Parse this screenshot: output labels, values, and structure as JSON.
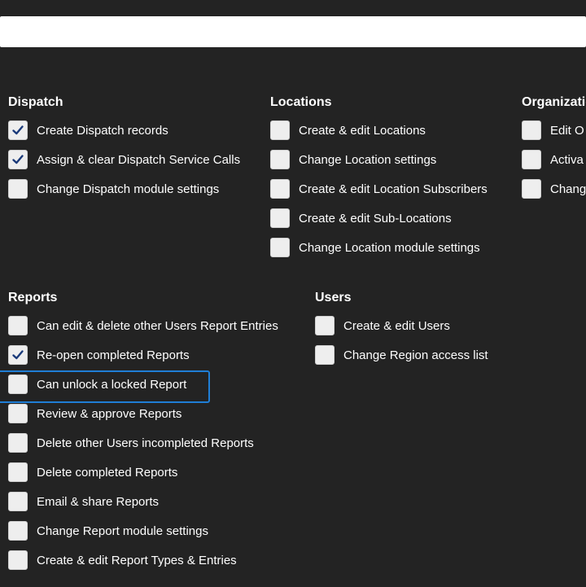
{
  "search": {
    "value": ""
  },
  "dispatch": {
    "title": "Dispatch",
    "items": [
      {
        "label": "Create Dispatch records",
        "checked": true
      },
      {
        "label": "Assign & clear Dispatch Service Calls",
        "checked": true
      },
      {
        "label": "Change Dispatch module settings",
        "checked": false
      }
    ]
  },
  "locations": {
    "title": "Locations",
    "items": [
      {
        "label": "Create & edit Locations",
        "checked": false
      },
      {
        "label": "Change Location settings",
        "checked": false
      },
      {
        "label": "Create & edit Location Subscribers",
        "checked": false
      },
      {
        "label": "Create & edit Sub-Locations",
        "checked": false
      },
      {
        "label": "Change Location module settings",
        "checked": false
      }
    ]
  },
  "organization": {
    "title": "Organizatio",
    "items": [
      {
        "label": "Edit O",
        "checked": false
      },
      {
        "label": "Activa",
        "checked": false
      },
      {
        "label": "Chang",
        "checked": false
      }
    ]
  },
  "reports": {
    "title": "Reports",
    "items": [
      {
        "label": "Can edit & delete other Users Report Entries",
        "checked": false
      },
      {
        "label": "Re-open completed Reports",
        "checked": true
      },
      {
        "label": "Can unlock a locked Report",
        "checked": false,
        "focused": true
      },
      {
        "label": "Review & approve Reports",
        "checked": false
      },
      {
        "label": "Delete other Users incompleted Reports",
        "checked": false
      },
      {
        "label": "Delete completed Reports",
        "checked": false
      },
      {
        "label": "Email & share Reports",
        "checked": false
      },
      {
        "label": "Change Report module settings",
        "checked": false
      },
      {
        "label": "Create & edit Report Types & Entries",
        "checked": false
      }
    ]
  },
  "users": {
    "title": "Users",
    "items": [
      {
        "label": "Create & edit Users",
        "checked": false
      },
      {
        "label": "Change Region access list",
        "checked": false
      }
    ]
  },
  "colors": {
    "check": "#1a3a7a",
    "focus": "#1f7ed6"
  }
}
